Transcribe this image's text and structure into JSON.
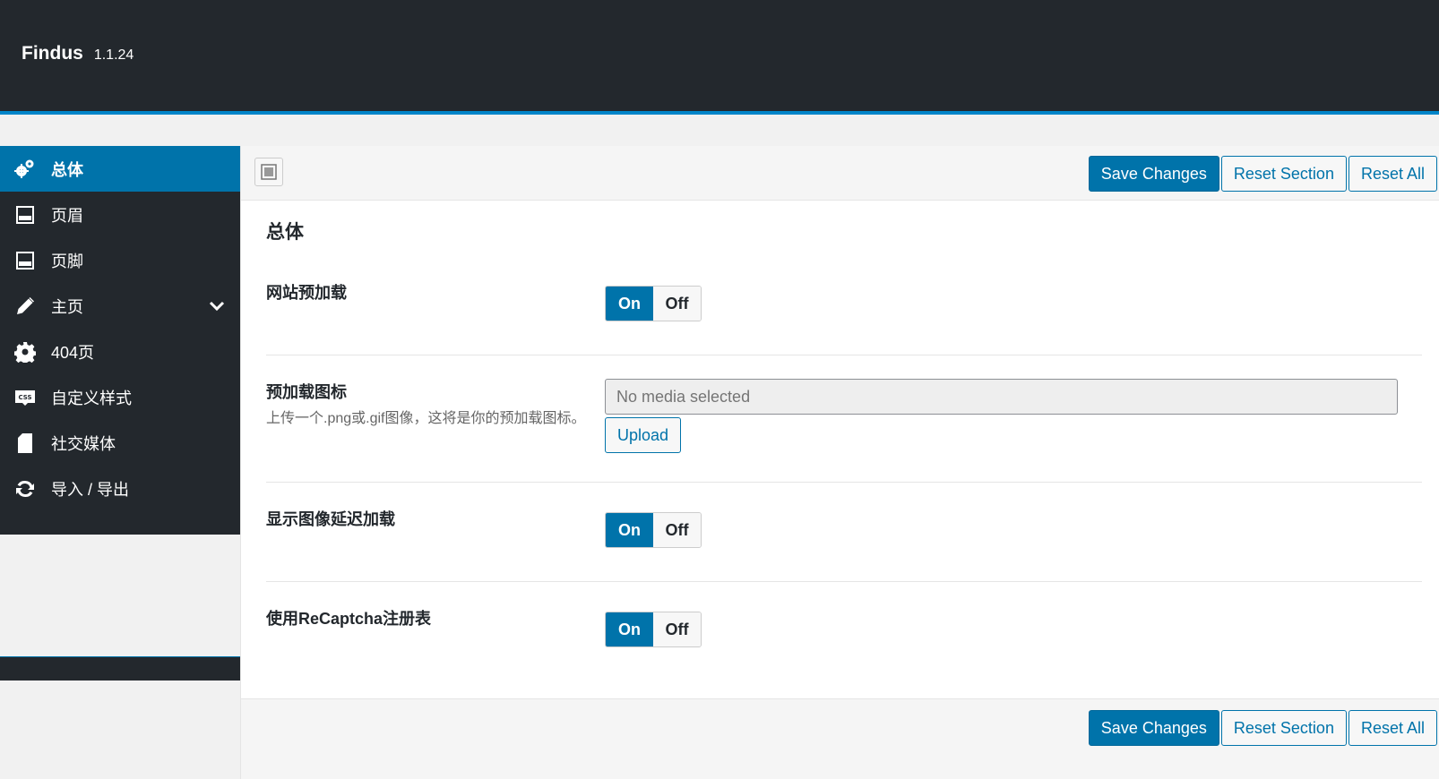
{
  "app": {
    "name": "Findus",
    "version": "1.1.24"
  },
  "sidebar": {
    "items": [
      {
        "label": "总体",
        "icon": "gears-icon",
        "active": true
      },
      {
        "label": "页眉",
        "icon": "header-layout-icon"
      },
      {
        "label": "页脚",
        "icon": "footer-layout-icon"
      },
      {
        "label": "主页",
        "icon": "pencil-icon",
        "expandable": true
      },
      {
        "label": "404页",
        "icon": "gear-icon"
      },
      {
        "label": "自定义样式",
        "icon": "css-icon"
      },
      {
        "label": "社交媒体",
        "icon": "file-icon"
      },
      {
        "label": "导入 / 导出",
        "icon": "refresh-icon"
      }
    ]
  },
  "toolbar": {
    "save_label": "Save Changes",
    "reset_section_label": "Reset Section",
    "reset_all_label": "Reset All"
  },
  "section": {
    "title": "总体",
    "fields": [
      {
        "label": "网站预加载",
        "type": "switch",
        "on_label": "On",
        "off_label": "Off",
        "value": "On"
      },
      {
        "label": "预加载图标",
        "type": "media",
        "description": "上传一个.png或.gif图像，这将是你的预加载图标。",
        "placeholder": "No media selected",
        "upload_label": "Upload"
      },
      {
        "label": "显示图像延迟加载",
        "type": "switch",
        "on_label": "On",
        "off_label": "Off",
        "value": "On"
      },
      {
        "label": "使用ReCaptcha注册表",
        "type": "switch",
        "on_label": "On",
        "off_label": "Off",
        "value": "On"
      }
    ]
  },
  "colors": {
    "header_bg": "#23282d",
    "accent": "#0073aa",
    "accent_bar": "#0085c9"
  }
}
